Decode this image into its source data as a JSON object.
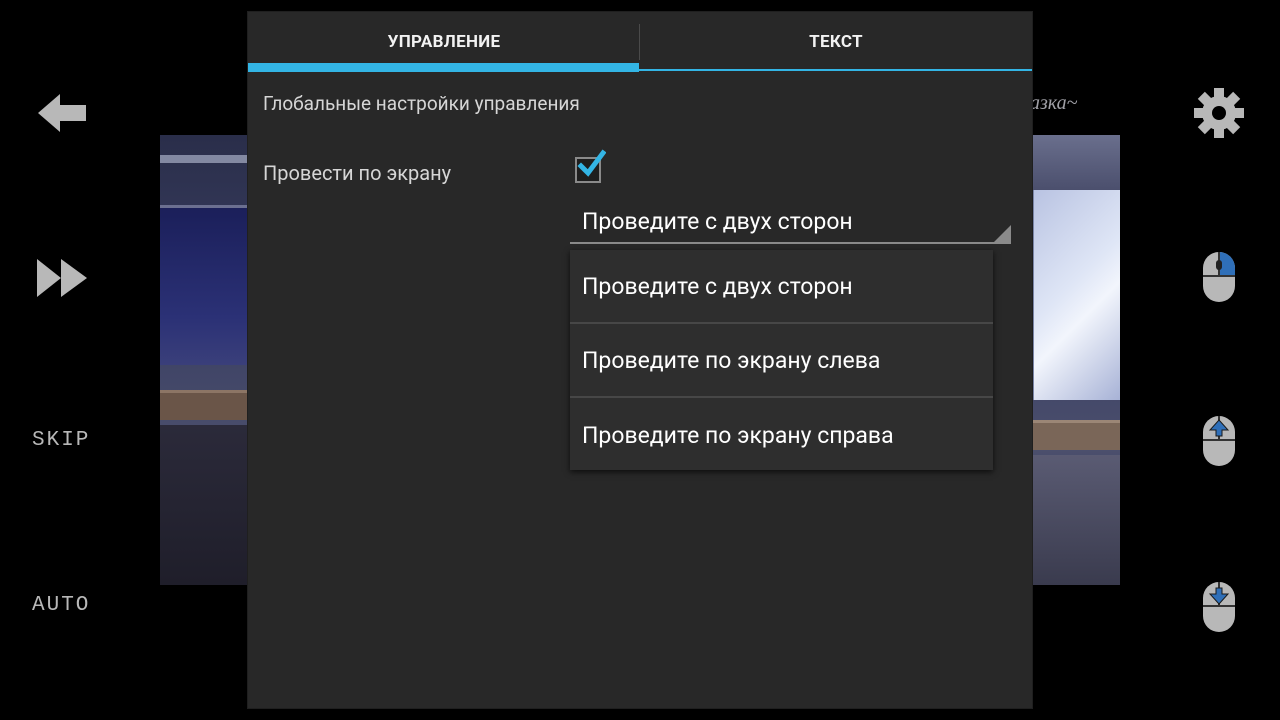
{
  "dialog": {
    "tabs": [
      {
        "label": "УПРАВЛЕНИЕ",
        "active": true
      },
      {
        "label": "ТЕКСТ",
        "active": false
      }
    ],
    "section_title": "Глобальные настройки управления",
    "swipe_setting": {
      "label": "Провести по экрану",
      "checked": true,
      "selected_value": "Проведите с двух сторон",
      "options": [
        "Проведите с двух сторон",
        "Проведите по экрану слева",
        "Проведите по экрану справа"
      ]
    }
  },
  "left_controls": {
    "back_icon": "back-arrow-icon",
    "fast_forward_icon": "fast-forward-icon",
    "skip_label": "SKIP",
    "auto_label": "AUTO"
  },
  "right_controls": {
    "settings_icon": "gear-icon",
    "mouse_icons": [
      "mouse-right-click-icon",
      "mouse-scroll-up-icon",
      "mouse-scroll-down-icon"
    ]
  },
  "background": {
    "title_fragment": "азка~"
  },
  "colors": {
    "accent": "#33b5e5",
    "dialog_bg": "#282828",
    "dropdown_bg": "#2e2e2e",
    "side_icon": "#b8b8b8"
  }
}
